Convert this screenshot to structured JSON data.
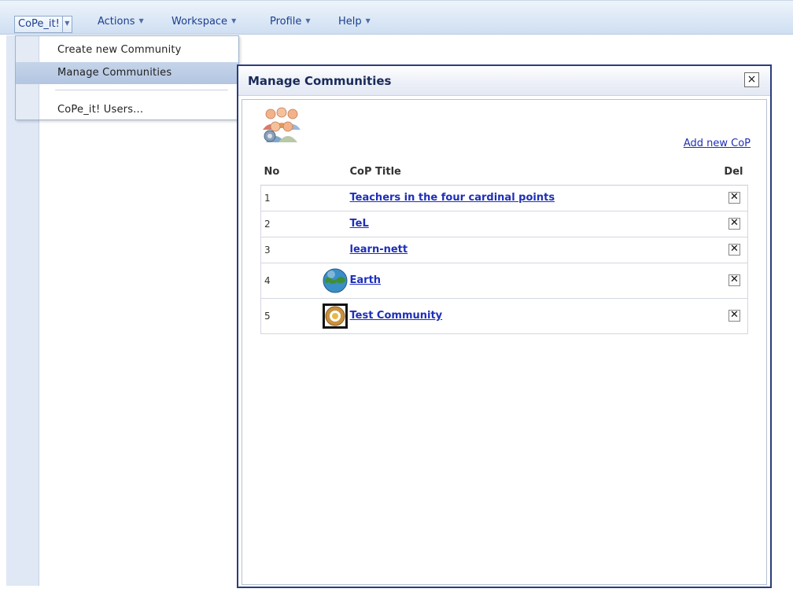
{
  "menubar": {
    "items": [
      {
        "label": "CoPe_it!"
      },
      {
        "label": "Actions"
      },
      {
        "label": "Workspace"
      },
      {
        "label": "Profile"
      },
      {
        "label": "Help"
      }
    ]
  },
  "dropdown": {
    "items": [
      {
        "label": "Create new Community"
      },
      {
        "label": "Manage Communities"
      },
      {
        "label": "CoPe_it! Users..."
      }
    ]
  },
  "window": {
    "title": "Manage Communities",
    "close": "×",
    "add_link": "Add new CoP",
    "table": {
      "headers": [
        "No",
        "CoP Title",
        "Del"
      ],
      "rows": [
        {
          "no": "1",
          "title": "Teachers in the four cardinal points",
          "icon": ""
        },
        {
          "no": "2",
          "title": "TeL",
          "icon": ""
        },
        {
          "no": "3",
          "title": "learn-nett",
          "icon": ""
        },
        {
          "no": "4",
          "title": "Earth",
          "icon": "earth-icon"
        },
        {
          "no": "5",
          "title": "Test Community",
          "icon": "sun-badge-icon"
        }
      ]
    }
  },
  "colors": {
    "link": "#1e2fb8",
    "title": "#1a2a5a",
    "accent": "#2c3d7a"
  }
}
